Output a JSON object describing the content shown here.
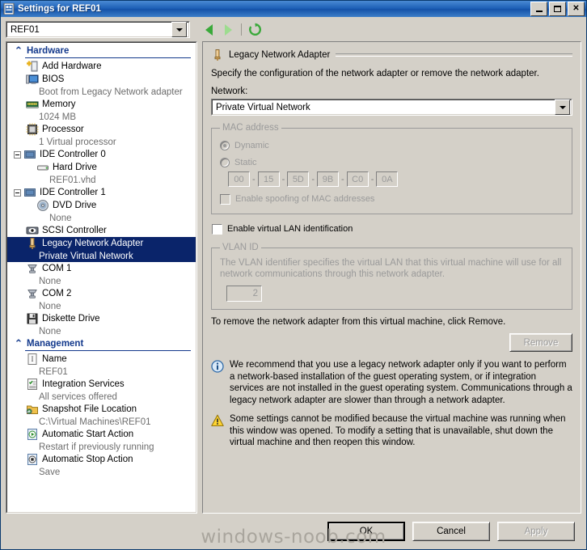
{
  "window": {
    "title": "Settings for REF01",
    "icon": "settings-window-icon",
    "minimize_label": "",
    "maximize_label": "",
    "close_label": "✕"
  },
  "toolbar": {
    "vm_selector_value": "REF01",
    "back_icon": "back-arrow-icon",
    "forward_icon": "forward-arrow-icon",
    "refresh_icon": "refresh-icon"
  },
  "tree": {
    "groups": [
      {
        "title": "Hardware",
        "nodes": [
          {
            "label": "Add Hardware",
            "sub": "",
            "icon": "add-hardware-icon",
            "indent": 1,
            "expander": "none",
            "selected": false
          },
          {
            "label": "BIOS",
            "sub": "Boot from Legacy Network adapter",
            "icon": "bios-icon",
            "indent": 1,
            "expander": "none",
            "selected": false
          },
          {
            "label": "Memory",
            "sub": "1024 MB",
            "icon": "memory-icon",
            "indent": 1,
            "expander": "none",
            "selected": false
          },
          {
            "label": "Processor",
            "sub": "1 Virtual processor",
            "icon": "processor-icon",
            "indent": 1,
            "expander": "none",
            "selected": false
          },
          {
            "label": "IDE Controller 0",
            "sub": "",
            "icon": "ide-controller-icon",
            "indent": 0,
            "expander": "minus",
            "selected": false
          },
          {
            "label": "Hard Drive",
            "sub": "REF01.vhd",
            "icon": "hard-drive-icon",
            "indent": 2,
            "expander": "none",
            "selected": false
          },
          {
            "label": "IDE Controller 1",
            "sub": "",
            "icon": "ide-controller-icon",
            "indent": 0,
            "expander": "minus",
            "selected": false
          },
          {
            "label": "DVD Drive",
            "sub": "None",
            "icon": "dvd-drive-icon",
            "indent": 2,
            "expander": "none",
            "selected": false
          },
          {
            "label": "SCSI Controller",
            "sub": "",
            "icon": "scsi-controller-icon",
            "indent": 1,
            "expander": "none",
            "selected": false
          },
          {
            "label": "Legacy Network Adapter",
            "sub": "Private Virtual Network",
            "icon": "network-adapter-icon",
            "indent": 1,
            "expander": "none",
            "selected": true
          },
          {
            "label": "COM 1",
            "sub": "None",
            "icon": "com-port-icon",
            "indent": 1,
            "expander": "none",
            "selected": false
          },
          {
            "label": "COM 2",
            "sub": "None",
            "icon": "com-port-icon",
            "indent": 1,
            "expander": "none",
            "selected": false
          },
          {
            "label": "Diskette Drive",
            "sub": "None",
            "icon": "diskette-drive-icon",
            "indent": 1,
            "expander": "none",
            "selected": false
          }
        ]
      },
      {
        "title": "Management",
        "nodes": [
          {
            "label": "Name",
            "sub": "REF01",
            "icon": "name-icon",
            "indent": 1,
            "expander": "none",
            "selected": false
          },
          {
            "label": "Integration Services",
            "sub": "All services offered",
            "icon": "integration-services-icon",
            "indent": 1,
            "expander": "none",
            "selected": false
          },
          {
            "label": "Snapshot File Location",
            "sub": "C:\\Virtual Machines\\REF01",
            "icon": "snapshot-folder-icon",
            "indent": 1,
            "expander": "none",
            "selected": false
          },
          {
            "label": "Automatic Start Action",
            "sub": "Restart if previously running",
            "icon": "start-action-icon",
            "indent": 1,
            "expander": "none",
            "selected": false
          },
          {
            "label": "Automatic Stop Action",
            "sub": "Save",
            "icon": "stop-action-icon",
            "indent": 1,
            "expander": "none",
            "selected": false
          }
        ]
      }
    ]
  },
  "detail": {
    "header_title": "Legacy Network Adapter",
    "header_icon": "network-adapter-icon",
    "description": "Specify the configuration of the network adapter or remove the network adapter.",
    "network_label": "Network:",
    "network_value": "Private Virtual Network",
    "mac": {
      "legend": "MAC address",
      "dynamic_label": "Dynamic",
      "static_label": "Static",
      "selected": "Dynamic",
      "octets": [
        "00",
        "15",
        "5D",
        "9B",
        "C0",
        "0A"
      ],
      "separator": "-",
      "spoofing_label": "Enable spoofing of MAC addresses",
      "spoofing_checked": false
    },
    "vlan_enable_label": "Enable virtual LAN identification",
    "vlan_enable_checked": false,
    "vlan": {
      "legend": "VLAN ID",
      "description": "The VLAN identifier specifies the virtual LAN that this virtual machine will use for all network communications through this network adapter.",
      "value": "2"
    },
    "remove_text": "To remove the network adapter from this virtual machine, click Remove.",
    "remove_button": "Remove",
    "notes": [
      {
        "icon": "info-icon",
        "text": "We recommend that you use a legacy network adapter only if you want to perform a network-based installation of the guest operating system, or if integration services are not installed in the guest operating system. Communications through a legacy network adapter are slower than through a network adapter."
      },
      {
        "icon": "warning-icon",
        "text": "Some settings cannot be modified because the virtual machine was running when this window was opened. To modify a setting that is unavailable, shut down the virtual machine and then reopen this window."
      }
    ]
  },
  "footer": {
    "ok": "OK",
    "cancel": "Cancel",
    "apply": "Apply",
    "watermark": "windows-noob.com"
  },
  "colors": {
    "selection": "#0a246a",
    "group_title": "#13398c",
    "face": "#d4d0c8",
    "disabled_text": "#9a9a9a",
    "title_bar": "#1c5fb5"
  }
}
